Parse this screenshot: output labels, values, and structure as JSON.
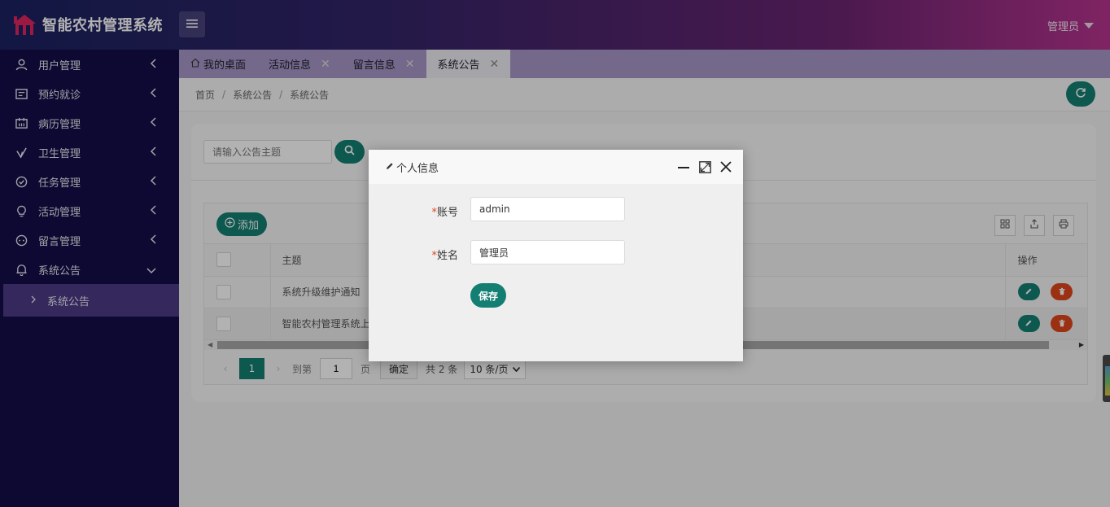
{
  "header": {
    "app_title": "智能农村管理系统",
    "user_name": "管理员",
    "logo_icon": "house-logo-icon",
    "menu_icon": "hamburger-icon",
    "colors": {
      "gradient_start": "#1b2260",
      "gradient_end": "#b7348f"
    }
  },
  "sidebar": {
    "items": [
      {
        "label": "用户管理",
        "icon": "user-icon"
      },
      {
        "label": "预约就诊",
        "icon": "calendar-list-icon"
      },
      {
        "label": "病历管理",
        "icon": "records-icon"
      },
      {
        "label": "卫生管理",
        "icon": "check-leaf-icon"
      },
      {
        "label": "任务管理",
        "icon": "check-circle-icon"
      },
      {
        "label": "活动管理",
        "icon": "bulb-icon"
      },
      {
        "label": "留言管理",
        "icon": "message-face-icon"
      },
      {
        "label": "系统公告",
        "icon": "bell-icon",
        "expanded": true
      }
    ],
    "sub_items": [
      {
        "label": "系统公告",
        "active": true
      }
    ]
  },
  "tabs": [
    {
      "label": "我的桌面",
      "icon": "home-icon",
      "closable": false,
      "active": false
    },
    {
      "label": "活动信息",
      "closable": true,
      "active": false
    },
    {
      "label": "留言信息",
      "closable": true,
      "active": false
    },
    {
      "label": "系统公告",
      "closable": true,
      "active": true
    }
  ],
  "breadcrumb": {
    "items": [
      "首页",
      "系统公告",
      "系统公告"
    ],
    "separator": "/"
  },
  "search": {
    "placeholder": "请输入公告主题",
    "value": ""
  },
  "toolbar": {
    "add_label": "添加"
  },
  "table": {
    "columns": {
      "subject": "主题",
      "ops": "操作"
    },
    "rows": [
      {
        "subject": "系统升级维护通知"
      },
      {
        "subject": "智能农村管理系统上"
      }
    ]
  },
  "pagination": {
    "current_page": "1",
    "goto_label": "到第",
    "goto_value": "1",
    "page_unit": "页",
    "confirm_label": "确定",
    "total_label": "共 2 条",
    "page_size_label": "10 条/页"
  },
  "modal": {
    "title": "个人信息",
    "fields": {
      "account": {
        "label": "账号",
        "value": "admin",
        "required_mark": "*"
      },
      "name": {
        "label": "姓名",
        "value": "管理员",
        "required_mark": "*"
      }
    },
    "save_label": "保存"
  },
  "colors": {
    "primary": "#137e72",
    "danger": "#e0461b",
    "sidebar_bg": "#130d48",
    "sidebar_active": "#4c3a86"
  }
}
